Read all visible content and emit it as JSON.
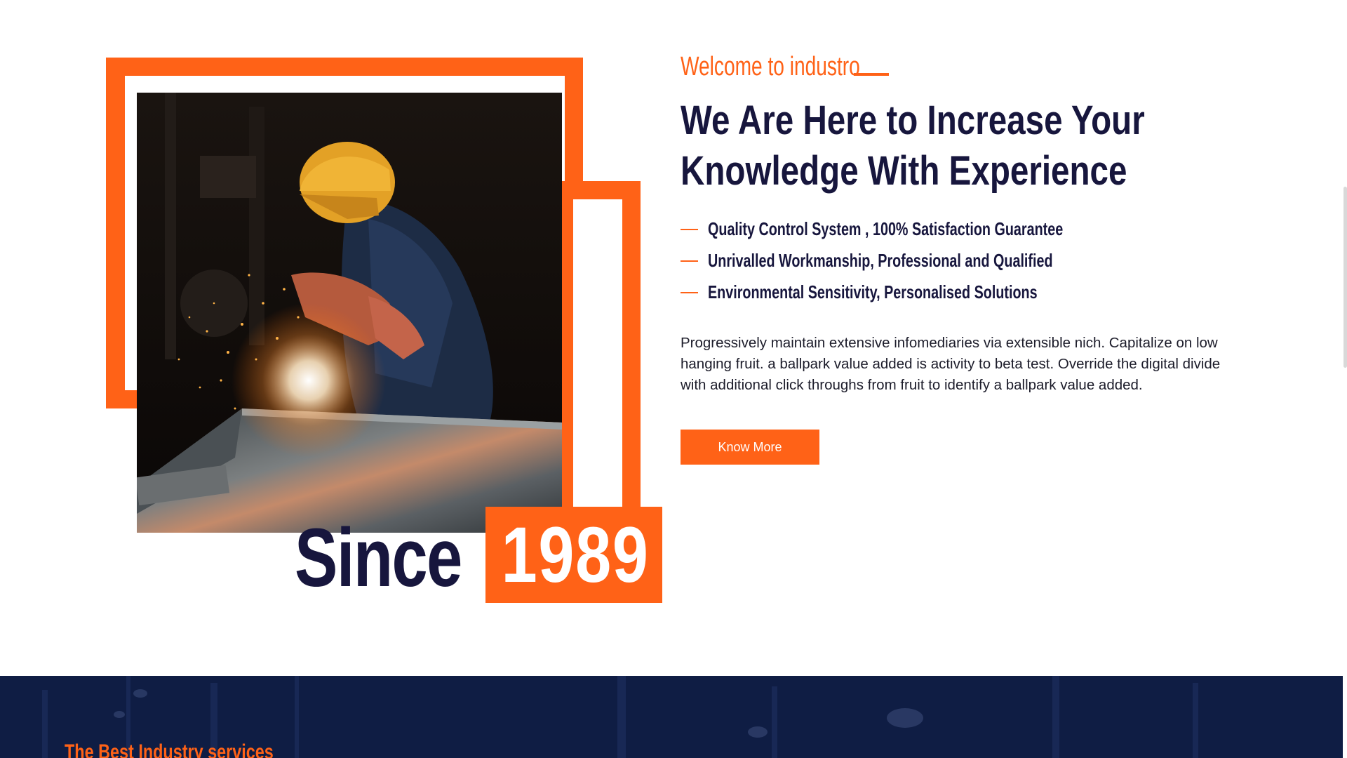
{
  "about": {
    "eyebrow": "Welcome to industro",
    "heading_line1": "We Are Here to Increase Your",
    "heading_line2": "Knowledge With Experience",
    "features": [
      "Quality Control System , 100% Satisfaction Guarantee",
      "Unrivalled Workmanship, Professional and Qualified",
      "Environmental Sensitivity, Personalised Solutions"
    ],
    "paragraph": "Progressively maintain extensive infomediaries via extensible nich. Capitalize on low hanging fruit. a ballpark value added is activity to beta test. Override the digital divide with additional click throughs from fruit to identify a ballpark value added.",
    "button_label": "Know More",
    "since_label": "Since",
    "since_year": "1989",
    "image_description": "welder-at-work-photo"
  },
  "services": {
    "eyebrow": "The Best Industry services"
  },
  "colors": {
    "accent": "#ff6217",
    "navy": "#17163d",
    "services_bg": "#0f1d44"
  }
}
